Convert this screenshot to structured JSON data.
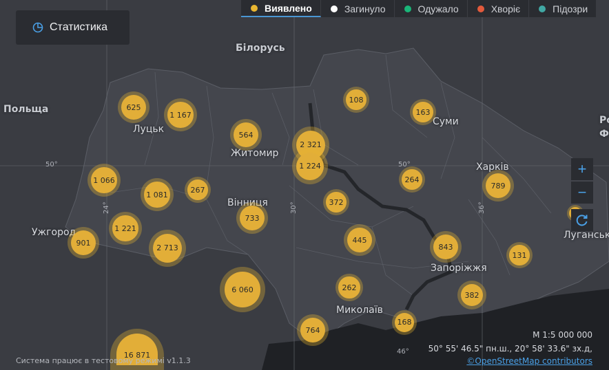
{
  "stats_button": {
    "label": "Статистика",
    "icon": "pie-chart-icon"
  },
  "legend": [
    {
      "label": "Виявлено",
      "color": "#e9b631",
      "active": true
    },
    {
      "label": "Загинуло",
      "color": "#ffffff",
      "active": false
    },
    {
      "label": "Одужало",
      "color": "#1ab679",
      "active": false
    },
    {
      "label": "Хворіє",
      "color": "#e35a3c",
      "active": false
    },
    {
      "label": "Підозри",
      "color": "#41a8a4",
      "active": false
    }
  ],
  "country_labels": {
    "belarus": "Білорусь",
    "poland": "Польща",
    "russia_partial": "Ро\nФе"
  },
  "city_labels": {
    "lutsk": "Луцьк",
    "zhytomyr": "Житомир",
    "sumy": "Суми",
    "kharkiv": "Харків",
    "vinnytsia": "Вінниця",
    "uzhhorod": "Ужгород",
    "zaporizhzhia": "Запоріжжя",
    "mykolaiv": "Миколаїв",
    "luhansk": "Луганськ"
  },
  "grid_labels": {
    "lat50_left": "50°",
    "lat50_right": "50°",
    "lon24": "24°",
    "lon30": "30°",
    "lon36": "36°",
    "lat46": "46°"
  },
  "clusters": [
    {
      "value": "625"
    },
    {
      "value": "1 167"
    },
    {
      "value": "564"
    },
    {
      "value": "2 321"
    },
    {
      "value": "1 224"
    },
    {
      "value": "108"
    },
    {
      "value": "163"
    },
    {
      "value": "1 066"
    },
    {
      "value": "1 081"
    },
    {
      "value": "267"
    },
    {
      "value": "264"
    },
    {
      "value": "789"
    },
    {
      "value": "372"
    },
    {
      "value": "733"
    },
    {
      "value": "1 221"
    },
    {
      "value": "901"
    },
    {
      "value": "2 713"
    },
    {
      "value": "445"
    },
    {
      "value": "843"
    },
    {
      "value": "131"
    },
    {
      "value": "6 060"
    },
    {
      "value": "262"
    },
    {
      "value": "382"
    },
    {
      "value": "764"
    },
    {
      "value": "168"
    },
    {
      "value": "16 871"
    },
    {
      "value": ""
    }
  ],
  "zoom": {
    "in": "+",
    "out": "−"
  },
  "footer": {
    "system_note": "Система працює в тестовому режимі v1.1.3",
    "scale": "М 1:5 000 000",
    "coords": "50° 55' 46.5\" пн.ш., 20° 58' 33.6\" зх.д,",
    "attribution": "©OpenStreetMap contributors"
  }
}
